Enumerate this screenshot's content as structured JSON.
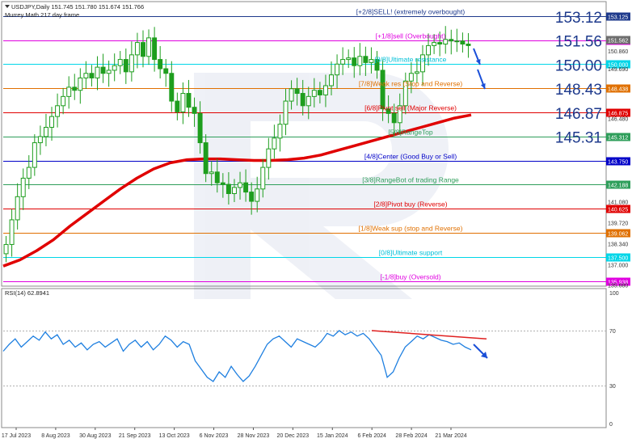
{
  "header": {
    "line1": "USDJPY,Daily  151.745 151.780 151.674 151.766",
    "line2": "Murrey Math 217 day frame"
  },
  "rsi_label": "RSI(14) 62.8941",
  "colors": {
    "candle": "#1e9e1e",
    "ma": "#e00000",
    "rsi_line": "#1e7fe0",
    "arrow": "#1a4fd8",
    "big_label": "#1e3a8c",
    "right_tag_bg": "#6e6e6e"
  },
  "big_labels": [
    "153.12",
    "151.56",
    "150.00",
    "148.43",
    "146.87",
    "145.31"
  ],
  "chart_data": [
    {
      "type": "candlestick",
      "symbol": "USDJPY",
      "timeframe": "Daily",
      "ylim": [
        135.65,
        154.0
      ],
      "x_tick_labels": [
        "17 Jul 2023",
        "8 Aug 2023",
        "30 Aug 2023",
        "21 Sep 2023",
        "13 Oct 2023",
        "6 Nov 2023",
        "28 Nov 2023",
        "20 Dec 2023",
        "15 Jan 2024",
        "6 Feb 2024",
        "28 Feb 2024",
        "21 Mar 2024"
      ],
      "y_tick_labels": [
        "153.125",
        "151.562",
        "150.860",
        "150.000",
        "149.690",
        "148.438",
        "146.875",
        "146.480",
        "145.312",
        "143.750",
        "142.188",
        "141.080",
        "140.625",
        "139.720",
        "139.062",
        "138.340",
        "137.500",
        "137.000",
        "135.938",
        "135.680"
      ],
      "current_price_tag": "151.562",
      "close_series": [
        138.3,
        139.9,
        141.4,
        142.6,
        143.3,
        144.9,
        145.3,
        145.9,
        146.6,
        147.3,
        147.9,
        148.5,
        148.3,
        149.1,
        149.4,
        149.1,
        149.8,
        149.4,
        149.6,
        149.9,
        150.3,
        149.5,
        150.6,
        151.4,
        150.5,
        151.7,
        150.3,
        149.7,
        149.4,
        147.6,
        146.9,
        148.1,
        147.2,
        146.8,
        144.9,
        142.9,
        143.0,
        142.3,
        142.2,
        141.6,
        142.0,
        142.3,
        141.7,
        141.1,
        141.9,
        143.3,
        144.5,
        145.2,
        146.1,
        147.6,
        148.4,
        148.1,
        147.3,
        147.9,
        148.3,
        148.0,
        148.6,
        149.3,
        150.0,
        150.3,
        150.4,
        149.9,
        150.5,
        150.1,
        150.3,
        149.6,
        147.1,
        146.8,
        146.2,
        147.3,
        148.9,
        149.4,
        149.5,
        150.6,
        151.2,
        151.4,
        151.3,
        151.6,
        151.5,
        151.5,
        151.3,
        151.2
      ],
      "series": [
        {
          "name": "Murrey Math levels",
          "values": [
            153.125,
            151.562,
            150.0,
            148.438,
            146.875,
            145.312,
            143.75,
            142.188,
            140.625,
            139.062,
            137.5,
            135.938
          ]
        },
        {
          "name": "Moving average",
          "values": [
            136.9,
            137.3,
            137.9,
            138.6,
            139.5,
            140.3,
            141.1,
            141.9,
            142.6,
            143.2,
            143.6,
            143.8,
            143.85,
            143.85,
            143.8,
            143.75,
            143.75,
            143.8,
            143.9,
            144.1,
            144.4,
            144.7,
            145.0,
            145.3,
            145.6,
            145.9,
            146.2,
            146.5,
            146.7
          ]
        }
      ],
      "levels": [
        {
          "price": 153.125,
          "label": "[+2/8]SELL! (extremely overbought)",
          "color": "#1e3a8c",
          "text_color": "#1e3a8c",
          "tag": "153.125"
        },
        {
          "price": 151.562,
          "label": "[+1/8]sell (Overbought)",
          "color": "#e000e0",
          "text_color": "#e000e0",
          "tag": "151.562"
        },
        {
          "price": 150.0,
          "label": "[8/8]Ultimate resistance",
          "color": "#00d6e8",
          "text_color": "#00c0d8",
          "tag": "150.000"
        },
        {
          "price": 148.438,
          "label": "[7/8]Weak res (Stop and Reverse)",
          "color": "#e07000",
          "text_color": "#e07000",
          "tag": "148.438"
        },
        {
          "price": 146.875,
          "label": "[6/8]Pivot sell (Major Reverse)",
          "color": "#e00000",
          "text_color": "#e00000",
          "tag": "146.875"
        },
        {
          "price": 145.312,
          "label": "[5/8]RangeTop",
          "color": "#2e9e5a",
          "text_color": "#2e9e5a",
          "tag": "145.312"
        },
        {
          "price": 143.75,
          "label": "[4/8]Center (Good Buy or Sell)",
          "color": "#0000c8",
          "text_color": "#0000c8",
          "tag": "143.750"
        },
        {
          "price": 142.188,
          "label": "[3/8]RangeBot of trading Range",
          "color": "#2e9e5a",
          "text_color": "#2e9e5a",
          "tag": "142.188"
        },
        {
          "price": 140.625,
          "label": "[2/8]Pivot buy (Reverse)",
          "color": "#e00000",
          "text_color": "#e00000",
          "tag": "140.625"
        },
        {
          "price": 139.062,
          "label": "[1/8]Weak sup (stop and Reverse)",
          "color": "#e07000",
          "text_color": "#e07000",
          "tag": "139.062"
        },
        {
          "price": 137.5,
          "label": "[0/8]Ultimate support",
          "color": "#00d6e8",
          "text_color": "#00c0d8",
          "tag": "137.500"
        },
        {
          "price": 135.938,
          "label": "[-1/8]buy (Oversold)",
          "color": "#e000e0",
          "text_color": "#e000e0",
          "tag": "135.938"
        }
      ],
      "grid": false
    },
    {
      "type": "line",
      "indicator": "RSI",
      "ylim": [
        0,
        100
      ],
      "y_tick_labels": [
        "100",
        "70",
        "30",
        "0"
      ],
      "values": [
        55,
        60,
        64,
        58,
        62,
        66,
        63,
        69,
        64,
        67,
        60,
        63,
        58,
        61,
        56,
        60,
        62,
        58,
        61,
        64,
        55,
        60,
        63,
        58,
        62,
        56,
        60,
        66,
        63,
        58,
        62,
        60,
        48,
        42,
        36,
        33,
        40,
        36,
        44,
        38,
        33,
        37,
        44,
        52,
        60,
        64,
        66,
        62,
        58,
        64,
        62,
        60,
        58,
        62,
        68,
        66,
        70,
        67,
        69,
        66,
        68,
        64,
        58,
        52,
        36,
        40,
        50,
        58,
        62,
        66,
        64,
        67,
        65,
        63,
        62,
        60,
        61,
        58,
        56
      ],
      "trendline": {
        "start": 70,
        "end": 64
      }
    }
  ]
}
